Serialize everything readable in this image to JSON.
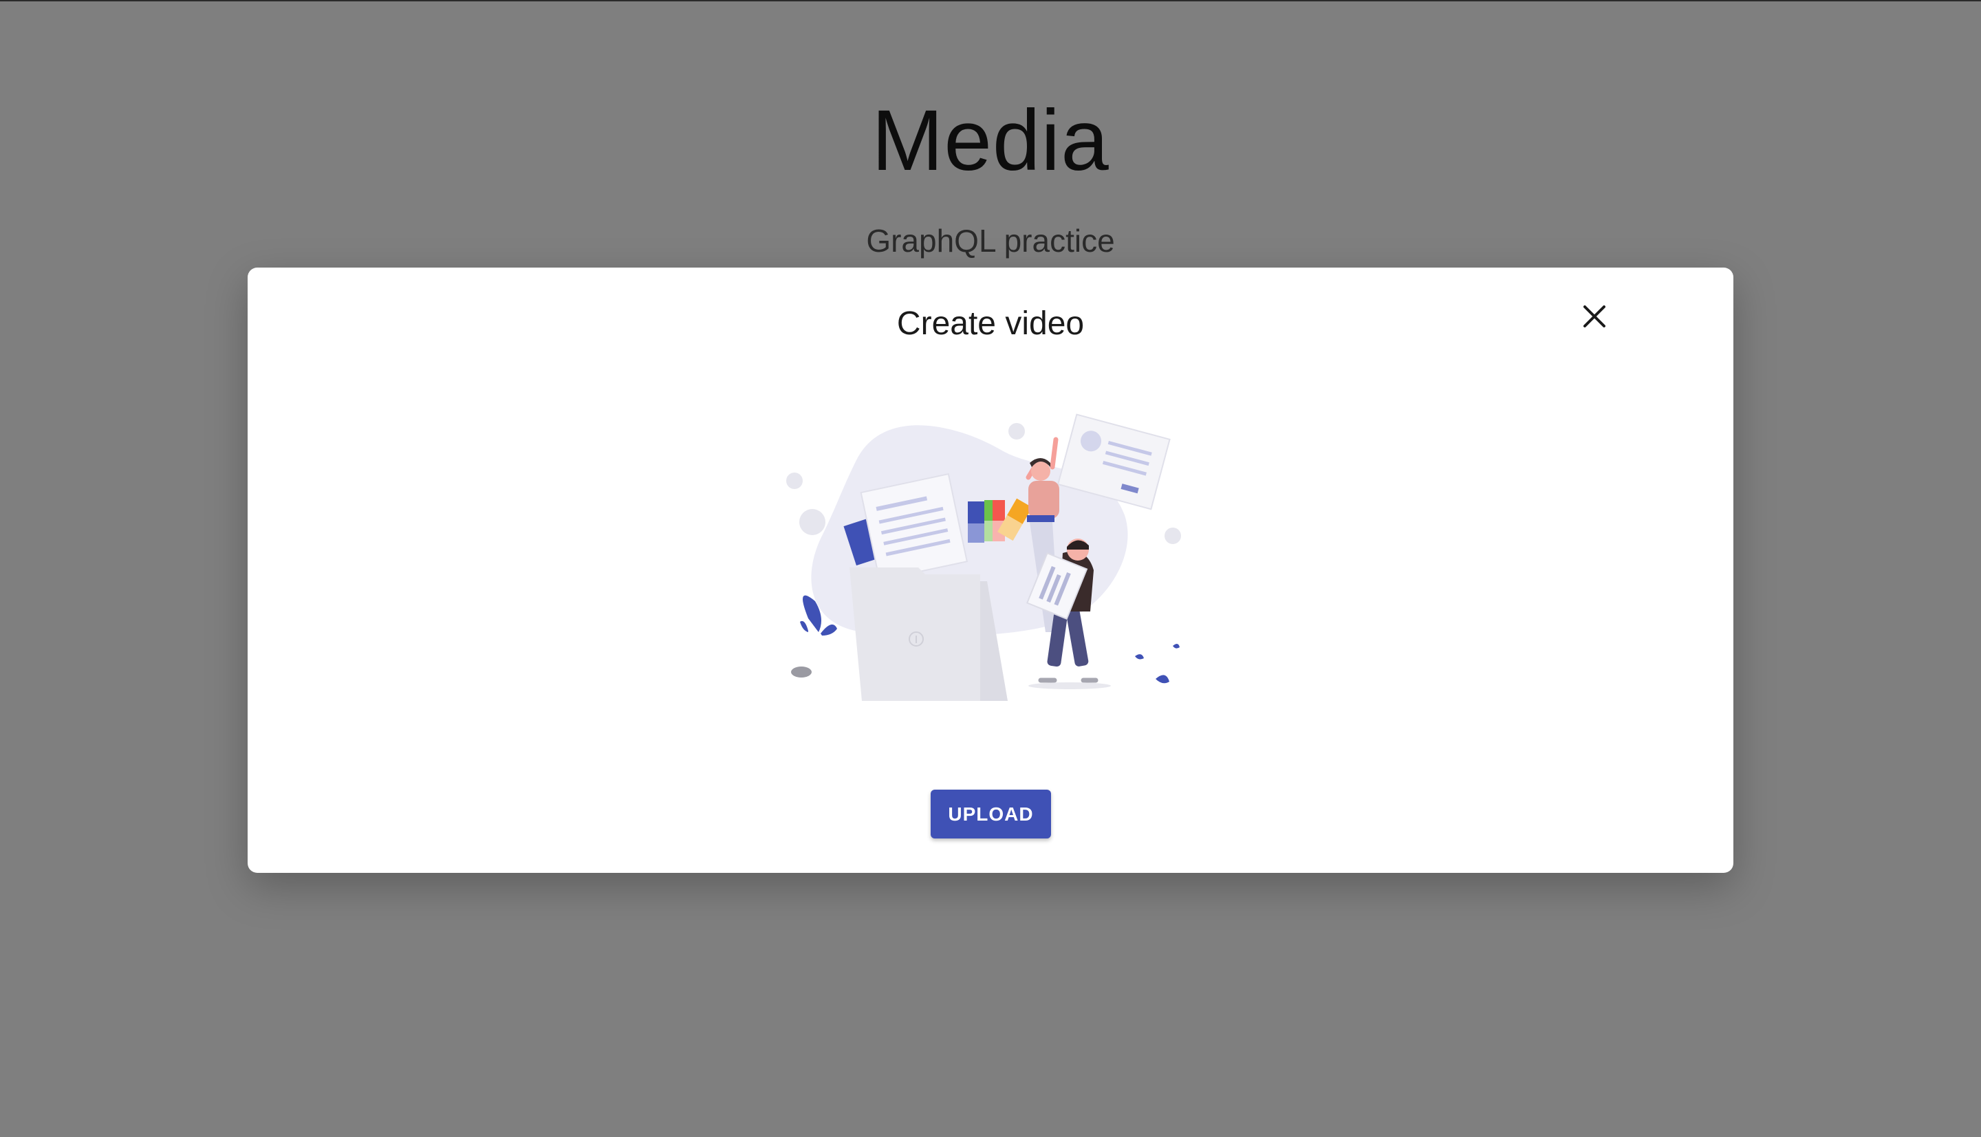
{
  "page": {
    "title": "Media",
    "subtitle": "GraphQL practice"
  },
  "dialog": {
    "title": "Create video",
    "close_icon": "close-icon",
    "illustration": "upload-folder-illustration",
    "upload_label": "UPLOAD"
  },
  "colors": {
    "backdrop": "rgba(0,0,0,0.5)",
    "primary": "#3f51b5",
    "dialog_bg": "#ffffff"
  }
}
